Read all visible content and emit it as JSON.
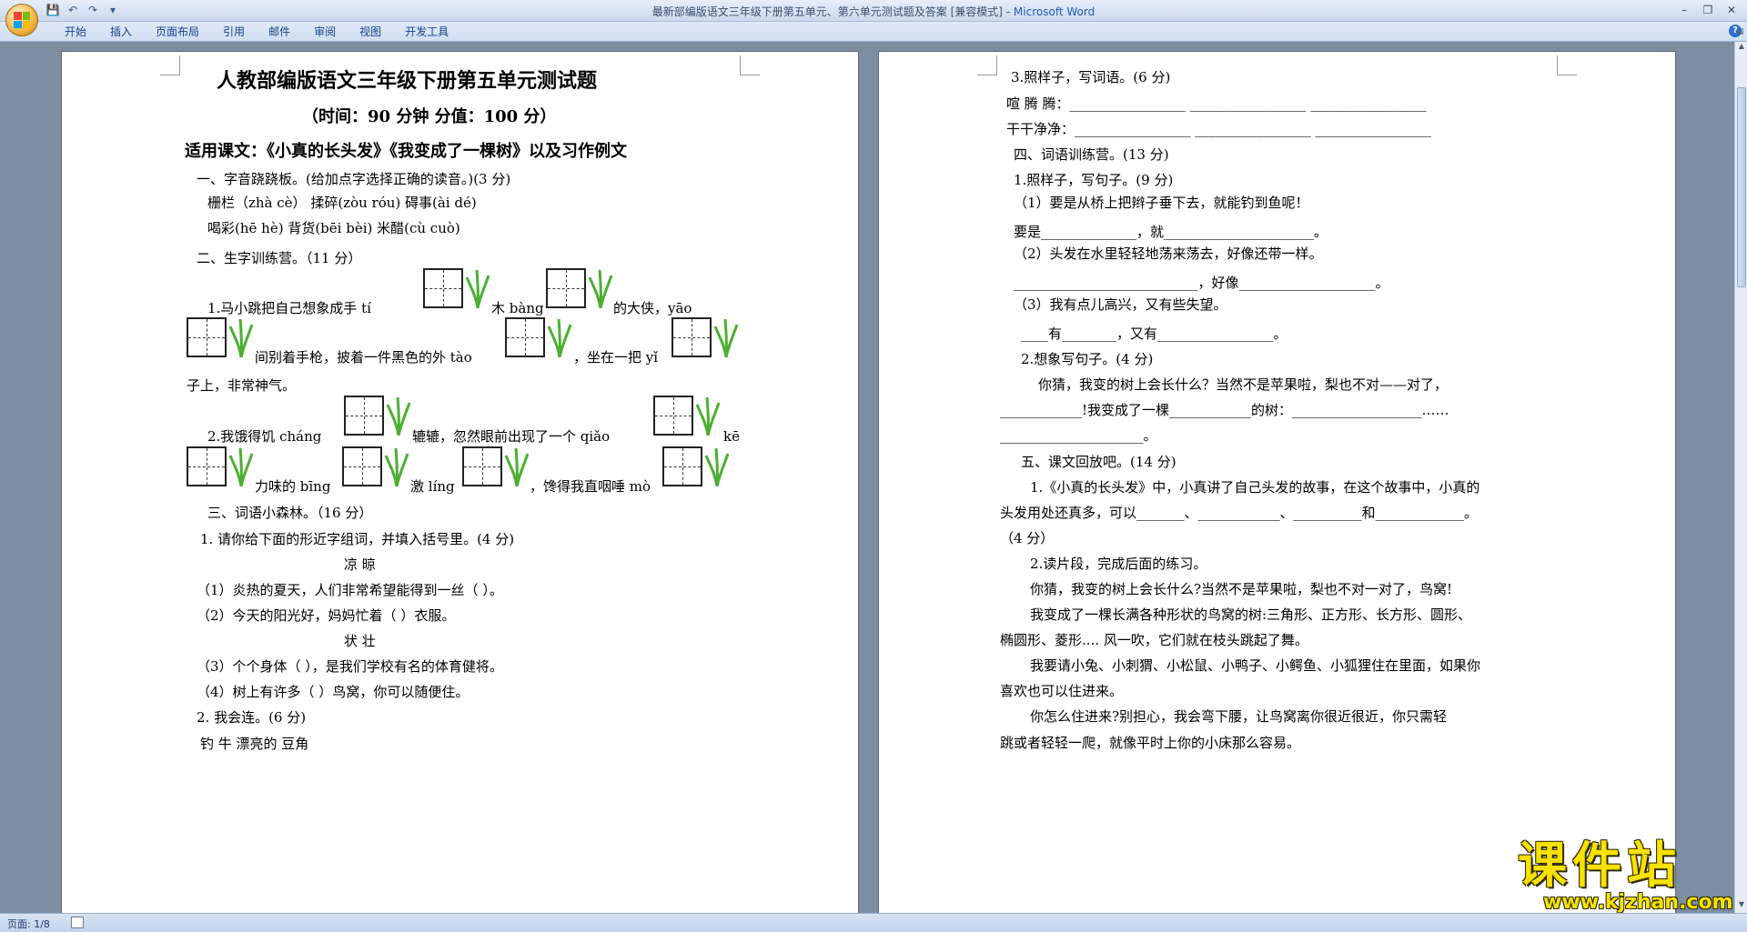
{
  "window": {
    "title_doc": "最新部编版语文三年级下册第五单元、第六单元测试题及答案 [兼容模式] - ",
    "title_app": "Microsoft Word",
    "controls": [
      "–",
      "❐",
      "✕"
    ]
  },
  "quick_access": [
    "💾",
    "↶",
    "↷",
    "▾"
  ],
  "ribbon": {
    "tabs": [
      "开始",
      "插入",
      "页面布局",
      "引用",
      "邮件",
      "审阅",
      "视图",
      "开发工具"
    ],
    "help": "?"
  },
  "statusbar": {
    "page": "页面: 1/8"
  },
  "watermark": {
    "text": "课件站",
    "url": "www.kjzhan.com"
  },
  "left_page": {
    "title": "人教部编版语文三年级下册第五单元测试题",
    "subtitle": "（时间：90 分钟      分值：100 分）",
    "applies": "适用课文：《小真的长头发》《我变成了一棵树》以及习作例文",
    "s1": "一、字音跷跷板。(给加点字选择正确的读音。)(3 分)",
    "s1_row1": "栅栏（zhà  cè）      揉碎(zòu   róu)      碍事(ài      dé)",
    "s1_row2": "喝彩(hē     hè)      背货(bēi    bèi)      米醋(cù     cuò)",
    "s2": "二、生字训练营。（11 分）",
    "s2_1a": "1.马小跳把自己想象成手 tí",
    "s2_1b": "木 bàng",
    "s2_1c": "的大侠，yāo",
    "s2_1d": "间别着手枪，披着一件黑色的外 tào",
    "s2_1e": "，坐在一把 yǐ",
    "s2_1f": "子上，非常神气。",
    "s2_2a": "2.我饿得饥 cháng",
    "s2_2b": "辘辘，忽然眼前出现了一个 qiǎo",
    "s2_2c": "kē",
    "s2_2d": "力味的 bīng",
    "s2_2e": "激 líng",
    "s2_2f": "，馋得我直咽唾 mò",
    "s3": "三、词语小森林。（16 分）",
    "s3_1": "1. 请你给下面的形近字组词，并填入括号里。(4 分)",
    "s3_w1": "凉        晾",
    "s3_q1": "（1）炎热的夏天，人们非常希望能得到一丝（            ）。",
    "s3_q2": "（2）今天的阳光好，妈妈忙着（           ）衣服。",
    "s3_w2": "状        壮",
    "s3_q3": "（3）个个身体（           ），是我们学校有名的体育健将。",
    "s3_q4": "（4）树上有许多（          ）鸟窝，你可以随便住。",
    "s3_2": "2. 我会连。(6 分)",
    "s3_2row": "钓               牛                       漂亮的               豆角"
  },
  "right_page": {
    "q3": "3.照样子，写词语。(6 分)",
    "q3_a": "喧  腾  腾：_________________  _________________  _________________",
    "q3_b": "干干净净：_________________  _________________  _________________",
    "s4": "四、词语训练营。(13 分)",
    "s4_1": "1.照样子，写句子。(9 分)",
    "s4_1_1": "（1）要是从桥上把辫子垂下去，就能钓到鱼呢！",
    "s4_1_1a": "要是______________，就______________________。",
    "s4_1_2": "（2）头发在水里轻轻地荡来荡去，好像还带一样。",
    "s4_1_2a": "___________________________，好像____________________。",
    "s4_1_3": "（3）我有点儿高兴，又有些失望。",
    "s4_1_3a": "____有________，又有_________________。",
    "s4_2": "2.想象写句子。(4 分)",
    "s4_2p": "你猜，我变的树上会长什么？当然不是苹果啦，梨也不对——对了，",
    "s4_2a": "____________!我变成了一棵____________的树：___________________……",
    "s4_2b": "_____________________。",
    "s5": "五、课文回放吧。(14 分)",
    "s5_1": "1.《小真的长头发》中，小真讲了自己头发的故事，在这个故事中，小真的",
    "s5_1b": "头发用处还真多，可以_______、____________、__________和_____________。",
    "s5_1c": "（4 分）",
    "s5_2": "2.读片段，完成后面的练习。",
    "p1": "你猜，我变的树上会长什么?当然不是苹果啦，梨也不对一对了，鸟窝!",
    "p2": "我变成了一棵长满各种形状的鸟窝的树:三角形、正方形、长方形、圆形、",
    "p2b": "椭圆形、菱形.... 风一吹，它们就在枝头跳起了舞。",
    "p3": "我要请小兔、小刺猬、小松鼠、小鸭子、小鳄鱼、小狐狸住在里面，如果你",
    "p3b": "喜欢也可以住进来。",
    "p4": "你怎么住进来?别担心，我会弯下腰，让鸟窝离你很近很近，你只需轻",
    "p4b": "跳或者轻轻一爬，就像平时上你的小床那么容易。"
  }
}
